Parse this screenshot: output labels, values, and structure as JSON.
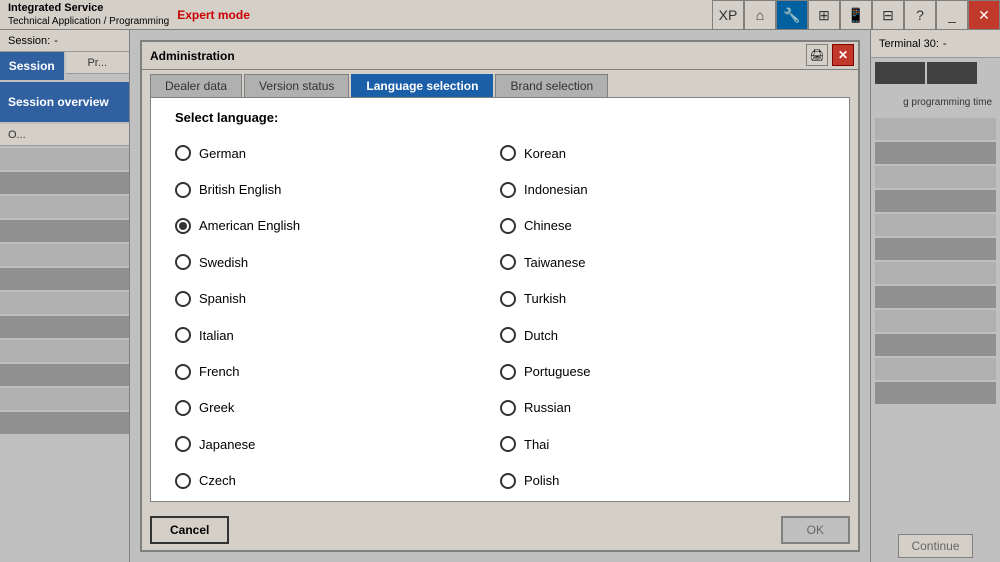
{
  "app": {
    "title": "Integrated Service",
    "subtitle": "Technical Application / Programming",
    "expert_mode": "Expert mode",
    "session_label": "Session:",
    "session_value": "-",
    "terminal_label": "Terminal 30:",
    "terminal_value": "-"
  },
  "toolbar": {
    "buttons": [
      "XP",
      "🏠",
      "🔧",
      "⊞",
      "📱",
      "⊟",
      "❓",
      "⊟",
      "✕"
    ]
  },
  "sidebar": {
    "session": "Session",
    "programming": "Pr...",
    "overview": "Session overview",
    "sub": "O..."
  },
  "dialog": {
    "title": "Administration",
    "select_language_label": "Select language:",
    "tabs": [
      {
        "id": "dealer-data",
        "label": "Dealer data",
        "active": false
      },
      {
        "id": "version-status",
        "label": "Version status",
        "active": false
      },
      {
        "id": "language-selection",
        "label": "Language selection",
        "active": true
      },
      {
        "id": "brand-selection",
        "label": "Brand selection",
        "active": false
      }
    ],
    "languages_left": [
      {
        "id": "german",
        "label": "German",
        "selected": false
      },
      {
        "id": "british-english",
        "label": "British English",
        "selected": false
      },
      {
        "id": "american-english",
        "label": "American English",
        "selected": true
      },
      {
        "id": "swedish",
        "label": "Swedish",
        "selected": false
      },
      {
        "id": "spanish",
        "label": "Spanish",
        "selected": false
      },
      {
        "id": "italian",
        "label": "Italian",
        "selected": false
      },
      {
        "id": "french",
        "label": "French",
        "selected": false
      },
      {
        "id": "greek",
        "label": "Greek",
        "selected": false
      },
      {
        "id": "japanese",
        "label": "Japanese",
        "selected": false
      },
      {
        "id": "czech",
        "label": "Czech",
        "selected": false
      }
    ],
    "languages_right": [
      {
        "id": "korean",
        "label": "Korean",
        "selected": false
      },
      {
        "id": "indonesian",
        "label": "Indonesian",
        "selected": false
      },
      {
        "id": "chinese",
        "label": "Chinese",
        "selected": false
      },
      {
        "id": "taiwanese",
        "label": "Taiwanese",
        "selected": false
      },
      {
        "id": "turkish",
        "label": "Turkish",
        "selected": false
      },
      {
        "id": "dutch",
        "label": "Dutch",
        "selected": false
      },
      {
        "id": "portuguese",
        "label": "Portuguese",
        "selected": false
      },
      {
        "id": "russian",
        "label": "Russian",
        "selected": false
      },
      {
        "id": "thai",
        "label": "Thai",
        "selected": false
      },
      {
        "id": "polish",
        "label": "Polish",
        "selected": false
      }
    ],
    "cancel_label": "Cancel",
    "ok_label": "OK"
  },
  "right_panel": {
    "programming_time_label": "g programming time",
    "continue_label": "Continue"
  }
}
